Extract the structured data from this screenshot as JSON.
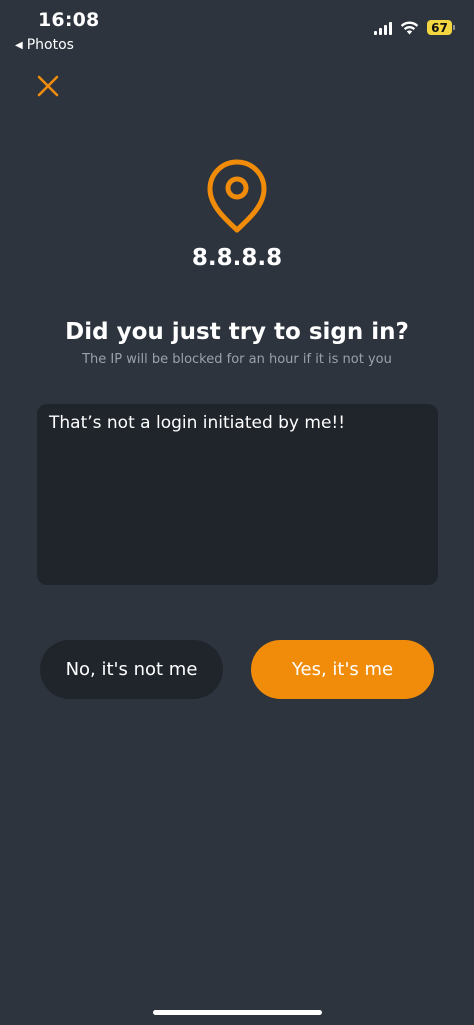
{
  "status_bar": {
    "time": "16:08",
    "back_label": "Photos",
    "back_arrow": "◀",
    "battery": "67",
    "battery_color": "#f2d740"
  },
  "colors": {
    "accent": "#f08c0a",
    "background": "#2d343e",
    "surface": "#20252c"
  },
  "icons": {
    "close": "close-icon",
    "location": "location-pin-icon"
  },
  "prompt": {
    "ip": "8.8.8.8",
    "title": "Did you just try to sign in?",
    "subtitle": "The IP will be blocked for an hour if it is not you",
    "message_value": "That’s not a login initiated by me!!"
  },
  "actions": {
    "deny_label": "No, it's not me",
    "confirm_label": "Yes, it's me"
  }
}
